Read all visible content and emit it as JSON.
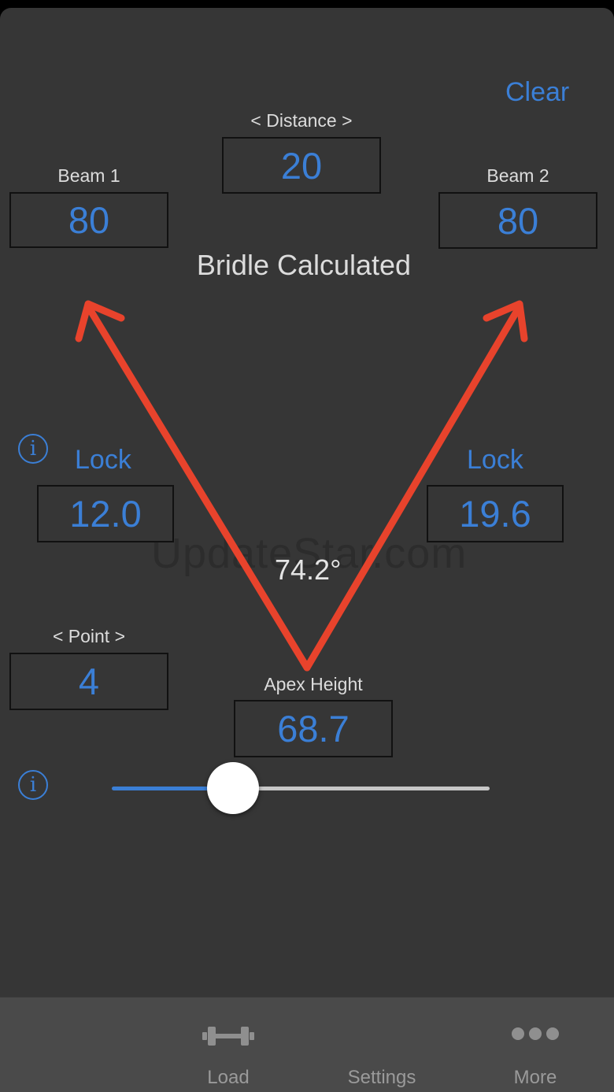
{
  "header": {
    "clear_label": "Clear"
  },
  "distance": {
    "label": "< Distance >",
    "value": "20"
  },
  "beam1": {
    "label": "Beam 1",
    "value": "80"
  },
  "beam2": {
    "label": "Beam 2",
    "value": "80"
  },
  "title": "Bridle Calculated",
  "lock_left": {
    "label": "Lock",
    "value": "12.0"
  },
  "lock_right": {
    "label": "Lock",
    "value": "19.6"
  },
  "angle": "74.2°",
  "watermark": "UpdateStar.com",
  "point": {
    "label": "< Point >",
    "value": "4"
  },
  "apex": {
    "label": "Apex Height",
    "value": "68.7"
  },
  "slider": {
    "value": 0.32
  },
  "colors": {
    "accent": "#3b7fd6",
    "arrow": "#e8432c",
    "background": "#363636"
  },
  "tabbar": {
    "tabs": [
      {
        "label": "Load",
        "icon": "dumbbell-icon"
      },
      {
        "label": "Settings",
        "icon": ""
      },
      {
        "label": "More",
        "icon": "more-dots-icon"
      }
    ]
  }
}
